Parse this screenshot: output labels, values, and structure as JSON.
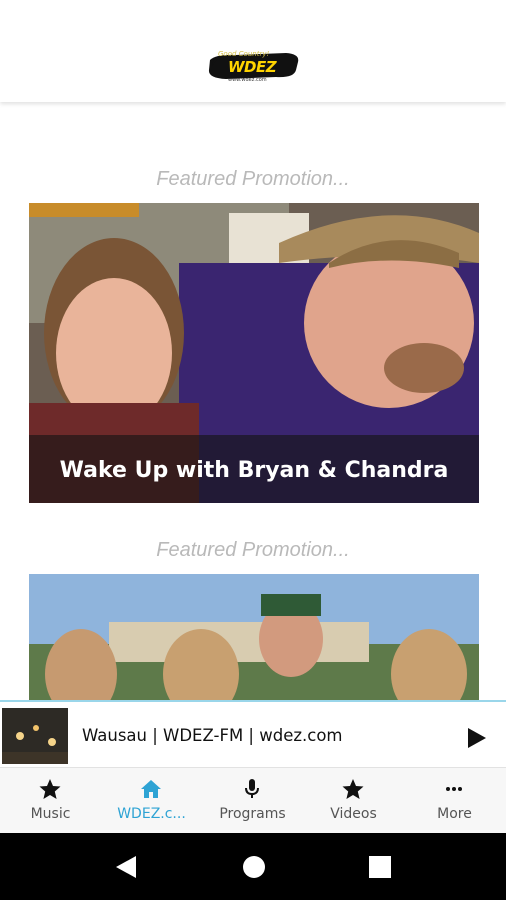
{
  "header": {
    "logo": {
      "tagline": "Good Country!",
      "brand": "WDEZ",
      "frequency": "101.9",
      "url": "www.wdez.com"
    }
  },
  "promotions": [
    {
      "heading": "Featured Promotion...",
      "title": "Wake Up with Bryan & Chandra"
    },
    {
      "heading": "Featured Promotion...",
      "title": ""
    }
  ],
  "player": {
    "station_text": "Wausau | WDEZ-FM | wdez.com",
    "play_icon": "play-icon"
  },
  "tabs": [
    {
      "label": "Music",
      "icon": "star-icon",
      "active": false
    },
    {
      "label": "WDEZ.c...",
      "icon": "home-icon",
      "active": true
    },
    {
      "label": "Programs",
      "icon": "microphone-icon",
      "active": false
    },
    {
      "label": "Videos",
      "icon": "star-icon",
      "active": false
    },
    {
      "label": "More",
      "icon": "more-icon",
      "active": false
    }
  ],
  "colors": {
    "accent": "#2ea3d4",
    "logo_yellow": "#ffd400",
    "heading_gray": "#b9b9b9"
  }
}
